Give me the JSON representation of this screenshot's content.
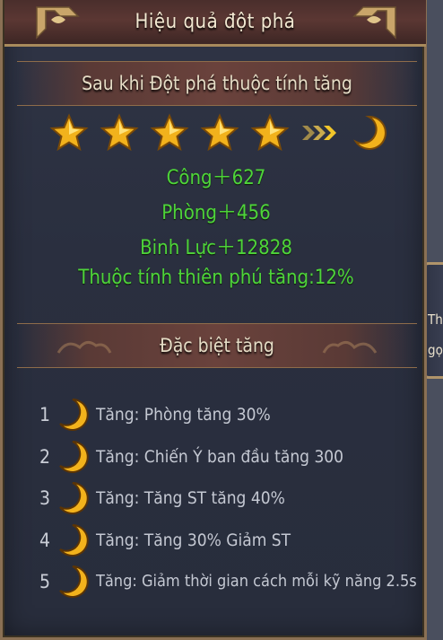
{
  "title": "Hiệu quả đột phá",
  "section1": {
    "header": "Sau khi Đột phá thuộc tính tăng",
    "star_count": 5,
    "stats": [
      "Công＋627",
      "Phòng＋456",
      "Binh Lực＋12828",
      "Thuộc tính thiên phú tăng:12%"
    ]
  },
  "section2": {
    "header": "Đặc biệt tăng",
    "items": [
      {
        "num": "1",
        "text": "Tăng:  Phòng tăng 30%"
      },
      {
        "num": "2",
        "text": "Tăng:  Chiến Ý ban đầu tăng 300"
      },
      {
        "num": "3",
        "text": "Tăng:  Tăng ST tăng 40%"
      },
      {
        "num": "4",
        "text": "Tăng:  Tăng 30% Giảm ST"
      },
      {
        "num": "5",
        "text": "Tăng:  Giảm thời gian cách mỗi kỹ năng 2.5s"
      }
    ]
  },
  "side_tab": {
    "line1": "Th",
    "line2": "gọ"
  },
  "colors": {
    "stat_green": "#4ed43a",
    "gold": "#f2b21c",
    "frame": "#8a7054"
  },
  "icons": [
    "star-icon",
    "arrow-chevrons-icon",
    "crescent-moon-icon"
  ]
}
